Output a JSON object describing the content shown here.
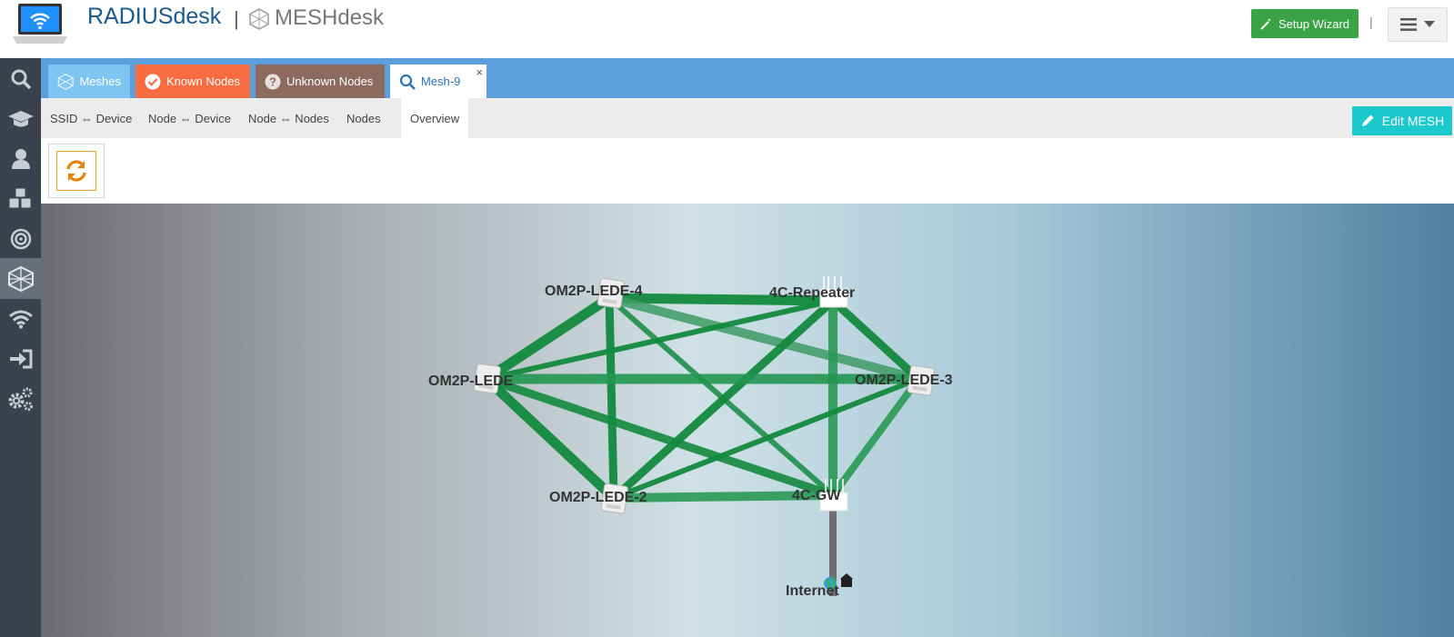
{
  "header": {
    "brand": "RADIUSdesk",
    "separator": "|",
    "mesh_brand": "MESHdesk",
    "setup_wizard_label": "Setup Wizard",
    "divider": "|"
  },
  "sidebar": {
    "items": [
      {
        "icon": "search-icon"
      },
      {
        "icon": "graduation-cap-icon"
      },
      {
        "icon": "user-icon"
      },
      {
        "icon": "cubes-icon"
      },
      {
        "icon": "target-icon"
      },
      {
        "icon": "mesh-icon",
        "active": true
      },
      {
        "icon": "wifi-icon"
      },
      {
        "icon": "sign-in-icon"
      },
      {
        "icon": "gears-icon"
      }
    ]
  },
  "tabs": [
    {
      "label": "Meshes",
      "icon": "mesh-icon",
      "color": "#7ec6f1"
    },
    {
      "label": "Known Nodes",
      "icon": "check-circle-icon",
      "color": "#f96c41"
    },
    {
      "label": "Unknown Nodes",
      "icon": "question-circle-icon",
      "color": "#8c6b5e"
    },
    {
      "label": "Mesh-9",
      "icon": "search-icon",
      "active": true,
      "close": "×"
    }
  ],
  "subtabs": [
    {
      "label": "SSID ⇔ Device"
    },
    {
      "label": "Node ⇔ Device"
    },
    {
      "label": "Node ⇔ Nodes"
    },
    {
      "label": "Nodes"
    },
    {
      "label": "Overview",
      "active": true
    }
  ],
  "edit_mesh_label": "Edit MESH",
  "graph": {
    "nodes": [
      {
        "id": "OM2P-LEDE-4",
        "label": "OM2P-LEDE-4",
        "kind": "om2p"
      },
      {
        "id": "4C-Repeater",
        "label": "4C-Repeater",
        "kind": "router"
      },
      {
        "id": "OM2P-LEDE",
        "label": "OM2P-LEDE",
        "kind": "om2p"
      },
      {
        "id": "OM2P-LEDE-3",
        "label": "OM2P-LEDE-3",
        "kind": "om2p"
      },
      {
        "id": "OM2P-LEDE-2",
        "label": "OM2P-LEDE-2",
        "kind": "om2p"
      },
      {
        "id": "4C-GW",
        "label": "4C-GW",
        "kind": "router"
      },
      {
        "id": "Internet",
        "label": "Internet",
        "kind": "internet"
      }
    ],
    "link_colors": {
      "strong": "#138a3e",
      "medium": "#2a9a55",
      "light": "#4aa873",
      "wired": "#6e6e6e"
    }
  }
}
